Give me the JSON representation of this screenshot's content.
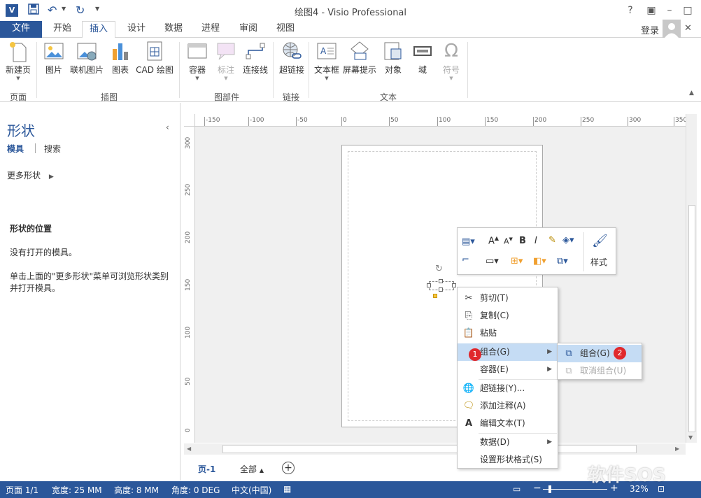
{
  "window": {
    "title": "绘图4 - Visio Professional",
    "login": "登录",
    "help": "?",
    "minimize": "–",
    "restore": "□",
    "close": "✕",
    "undo_symbol": "↶",
    "redo_symbol": "↻",
    "save_symbol": "▪"
  },
  "tabs": [
    "文件",
    "开始",
    "插入",
    "设计",
    "数据",
    "进程",
    "审阅",
    "视图"
  ],
  "ribbon": {
    "buttons": {
      "new_page": "新建页",
      "picture": "图片",
      "online_picture": "联机图片",
      "chart": "图表",
      "cad": "CAD 绘图",
      "container": "容器",
      "callout": "标注",
      "connector": "连接线",
      "hyperlink": "超链接",
      "textbox": "文本框",
      "screentip": "屏幕提示",
      "object": "对象",
      "field": "域",
      "symbol": "符号"
    },
    "groups": {
      "page": "页面",
      "illustration": "插图",
      "diagram_parts": "图部件",
      "link": "链接",
      "text": "文本"
    }
  },
  "shapes_pane": {
    "title": "形状",
    "tab_stencil": "模具",
    "tab_search": "搜索",
    "more_shapes": "更多形状",
    "section_title": "形状的位置",
    "no_stencil": "没有打开的模具。",
    "hint_line1": "单击上面的\"更多形状\"菜单可浏览形状类别",
    "hint_line2": "并打开模具。"
  },
  "ruler": {
    "h_ticks": [
      "-150",
      "-100",
      "-50",
      "0",
      "50",
      "100",
      "150",
      "200",
      "250",
      "300",
      "350"
    ],
    "v_ticks": [
      "300",
      "250",
      "200",
      "150",
      "100",
      "50",
      "0"
    ]
  },
  "mini_toolbar": {
    "style_label": "样式"
  },
  "context_menu": {
    "cut": "剪切(T)",
    "copy": "复制(C)",
    "paste": "粘贴",
    "group": "组合(G)",
    "container": "容器(E)",
    "hyperlink": "超链接(Y)...",
    "comment": "添加注释(A)",
    "edit_text": "编辑文本(T)",
    "data": "数据(D)",
    "format_shape": "设置形状格式(S)"
  },
  "submenu": {
    "group": "组合(G)",
    "ungroup": "取消组合(U)"
  },
  "badges": {
    "one": "1",
    "two": "2"
  },
  "page_tabs": {
    "page1": "页-1",
    "all": "全部"
  },
  "status": {
    "page": "页面 1/1",
    "width": "宽度: 25 MM",
    "height": "高度: 8 MM",
    "angle": "角度: 0 DEG",
    "lang": "中文(中国)",
    "zoom": "32%"
  },
  "watermark": "软件SOS",
  "colors": {
    "accent": "#2b579a",
    "badge": "#e0282c",
    "highlight": "#c5dcf4"
  }
}
